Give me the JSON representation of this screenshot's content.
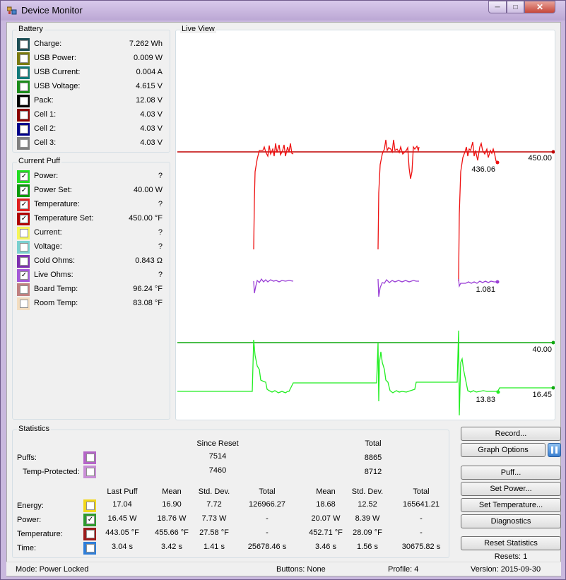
{
  "window": {
    "title": "Device Monitor"
  },
  "battery": {
    "title": "Battery",
    "items": [
      {
        "label": "Charge:",
        "value": "7.262 Wh",
        "color": "#1d4e55",
        "checked": false
      },
      {
        "label": "USB Power:",
        "value": "0.009 W",
        "color": "#7a7a10",
        "checked": false
      },
      {
        "label": "USB Current:",
        "value": "0.004 A",
        "color": "#127a7a",
        "checked": false
      },
      {
        "label": "USB Voltage:",
        "value": "4.615 V",
        "color": "#1a8c1a",
        "checked": false
      },
      {
        "label": "Pack:",
        "value": "12.08 V",
        "color": "#000000",
        "checked": false
      },
      {
        "label": "Cell 1:",
        "value": "4.03 V",
        "color": "#8b0000",
        "checked": false
      },
      {
        "label": "Cell 2:",
        "value": "4.03 V",
        "color": "#00008b",
        "checked": false
      },
      {
        "label": "Cell 3:",
        "value": "4.03 V",
        "color": "#808080",
        "checked": false
      }
    ]
  },
  "current_puff": {
    "title": "Current Puff",
    "items": [
      {
        "label": "Power:",
        "value": "?",
        "color": "#22dd22",
        "checked": true
      },
      {
        "label": "Power Set:",
        "value": "40.00 W",
        "color": "#0a9a0a",
        "checked": true
      },
      {
        "label": "Temperature:",
        "value": "?",
        "color": "#e02020",
        "checked": true
      },
      {
        "label": "Temperature Set:",
        "value": "450.00 °F",
        "color": "#b00000",
        "checked": true
      },
      {
        "label": "Current:",
        "value": "?",
        "color": "#f5f55a",
        "checked": false
      },
      {
        "label": "Voltage:",
        "value": "?",
        "color": "#7ad0d0",
        "checked": false
      },
      {
        "label": "Cold Ohms:",
        "value": "0.843 Ω",
        "color": "#7d2fb0",
        "checked": false
      },
      {
        "label": "Live Ohms:",
        "value": "?",
        "color": "#a458d8",
        "checked": true
      },
      {
        "label": "Board Temp:",
        "value": "96.24 °F",
        "color": "#c08080",
        "checked": false
      },
      {
        "label": "Room Temp:",
        "value": "83.08 °F",
        "color": "#f3ddc0",
        "checked": false
      }
    ]
  },
  "live_view": {
    "title": "Live View",
    "labels": {
      "temp_set": "450.00",
      "temp_last": "436.06",
      "ohms_last": "1.081",
      "power_set": "40.00",
      "power_last": "13.83",
      "power_right": "16.45"
    },
    "colors": {
      "temp": "#ee1010",
      "power": "#22ee22",
      "power_set": "#0ea80e",
      "ohms": "#9a3fd6"
    }
  },
  "statistics": {
    "title": "Statistics",
    "headers": {
      "since_reset": "Since Reset",
      "total": "Total",
      "last_puff": "Last Puff",
      "mean": "Mean",
      "std_dev": "Std. Dev.",
      "total_col": "Total",
      "mean2": "Mean",
      "std_dev2": "Std. Dev.",
      "total2": "Total"
    },
    "puffs": {
      "label": "Puffs:",
      "since_reset": "7514",
      "total": "8865",
      "color": "#b565c8"
    },
    "temp_protected": {
      "label": "Temp-Protected:",
      "since_reset": "7460",
      "total": "8712",
      "color": "#c98ed6"
    },
    "rows": [
      {
        "label": "Energy:",
        "color": "#f2d71a",
        "checked": false,
        "cells": [
          "17.04",
          "16.90",
          "7.72",
          "126966.27",
          "18.68",
          "12.52",
          "165641.21"
        ]
      },
      {
        "label": "Power:",
        "color": "#2e9a2e",
        "checked": true,
        "cells": [
          "16.45 W",
          "18.76 W",
          "7.73 W",
          "-",
          "20.07 W",
          "8.39 W",
          "-"
        ]
      },
      {
        "label": "Temperature:",
        "color": "#9b1c1c",
        "checked": false,
        "cells": [
          "443.05 °F",
          "455.66 °F",
          "27.58 °F",
          "-",
          "452.71 °F",
          "28.09 °F",
          "-"
        ]
      },
      {
        "label": "Time:",
        "color": "#2f7ed8",
        "checked": false,
        "cells": [
          "3.04 s",
          "3.42 s",
          "1.41 s",
          "25678.46 s",
          "3.46 s",
          "1.56 s",
          "30675.82 s"
        ]
      }
    ]
  },
  "buttons": {
    "record": "Record...",
    "graph_options": "Graph Options",
    "puff": "Puff...",
    "set_power": "Set Power...",
    "set_temperature": "Set Temperature...",
    "diagnostics": "Diagnostics",
    "reset_statistics": "Reset Statistics",
    "resets": "Resets: 1"
  },
  "status": {
    "mode": "Mode: Power Locked",
    "buttons": "Buttons: None",
    "profile": "Profile: 4",
    "version": "Version: 2015-09-30"
  }
}
